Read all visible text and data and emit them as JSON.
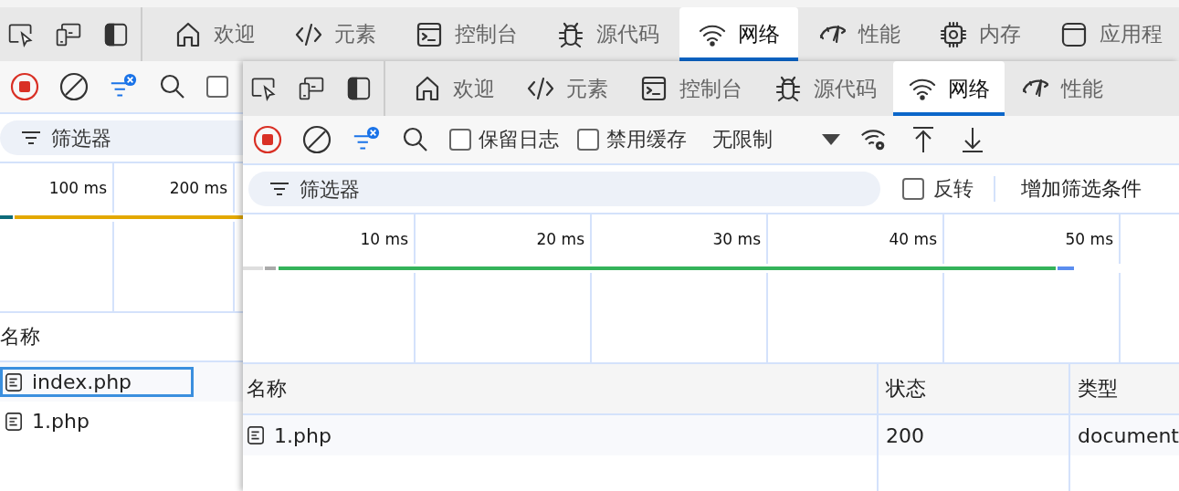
{
  "back_panel": {
    "tabs": [
      {
        "label": "欢迎",
        "selected": false
      },
      {
        "label": "元素",
        "selected": false
      },
      {
        "label": "控制台",
        "selected": false
      },
      {
        "label": "源代码",
        "selected": false
      },
      {
        "label": "网络",
        "selected": true
      },
      {
        "label": "性能",
        "selected": false
      },
      {
        "label": "内存",
        "selected": false
      },
      {
        "label": "应用程",
        "selected": false
      }
    ],
    "toolbar": {
      "checkboxes": [
        {
          "checked": false
        }
      ]
    },
    "filter": {
      "placeholder": "筛选器"
    },
    "timeline": {
      "ticks": [
        "100 ms",
        "200 ms"
      ]
    },
    "table": {
      "columns": [
        "名称"
      ],
      "rows": [
        {
          "name": "index.php",
          "selected": true
        },
        {
          "name": "1.php",
          "selected": false
        }
      ]
    }
  },
  "front_panel": {
    "tabs": [
      {
        "label": "欢迎",
        "selected": false
      },
      {
        "label": "元素",
        "selected": false
      },
      {
        "label": "控制台",
        "selected": false
      },
      {
        "label": "源代码",
        "selected": false
      },
      {
        "label": "网络",
        "selected": true
      },
      {
        "label": "性能",
        "selected": false
      }
    ],
    "toolbar": {
      "checkboxes": [
        {
          "label": "保留日志",
          "checked": false
        },
        {
          "label": "禁用缓存",
          "checked": false
        }
      ],
      "throttling": "无限制"
    },
    "filter": {
      "placeholder": "筛选器",
      "invert": {
        "label": "反转",
        "checked": false
      },
      "more_filters": "增加筛选条件"
    },
    "timeline": {
      "ticks": [
        "10 ms",
        "20 ms",
        "30 ms",
        "40 ms",
        "50 ms"
      ]
    },
    "table": {
      "columns": [
        "名称",
        "状态",
        "类型"
      ],
      "rows": [
        {
          "cells": [
            "1.php",
            "200",
            "document"
          ],
          "selected": false
        }
      ]
    }
  }
}
